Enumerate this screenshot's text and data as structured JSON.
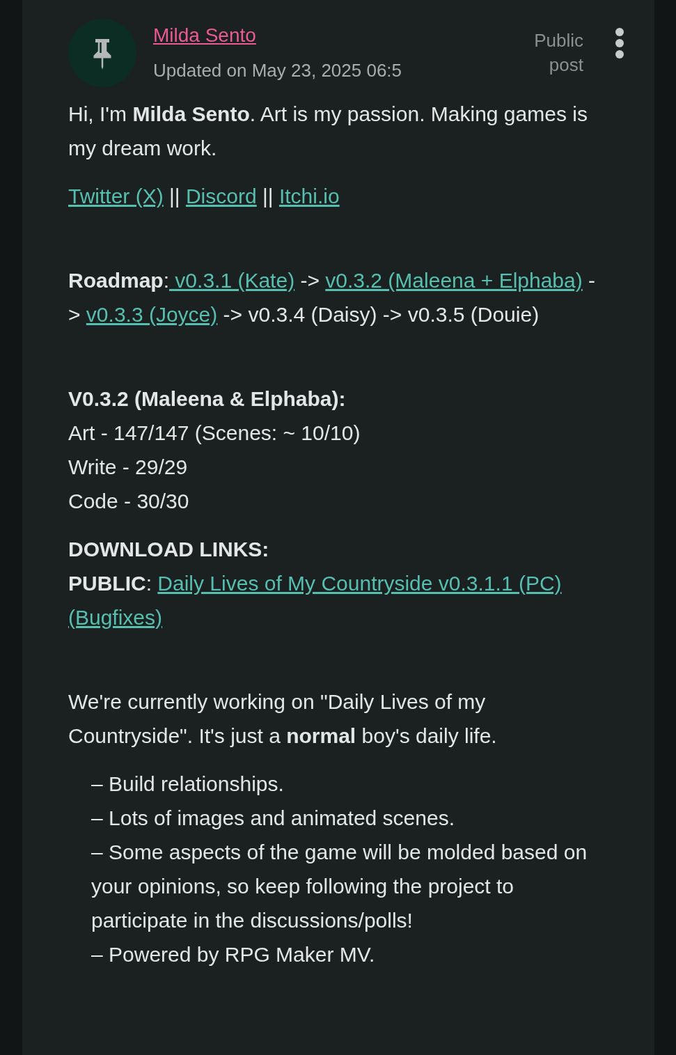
{
  "post": {
    "author": "Milda Sento",
    "updated": "Updated on May 23, 2025 06:5",
    "visibility": "Public post",
    "blocks": [
      {
        "kind": "paragraph",
        "lines": [
          [
            {
              "kind": "text",
              "text": "Hi, I'm **Milda Sento**. Art is my passion. Making games is my dream work."
            }
          ]
        ]
      },
      {
        "kind": "paragraph",
        "lines": [
          [
            {
              "kind": "link",
              "text": "Twitter (X)"
            },
            {
              "kind": "text",
              "text": " || "
            },
            {
              "kind": "link",
              "text": "Discord"
            },
            {
              "kind": "text",
              "text": " || "
            },
            {
              "kind": "link",
              "text": "Itchi.io"
            }
          ]
        ]
      },
      {
        "kind": "section",
        "lines": [
          [
            {
              "kind": "text",
              "text": "**Roadmap**:"
            },
            {
              "kind": "link",
              "text": " v0.3.1 (Kate)"
            },
            {
              "kind": "text",
              "text": " -> "
            },
            {
              "kind": "link",
              "text": "v0.3.2 (Maleena + Elphaba)"
            },
            {
              "kind": "text",
              "text": " -> "
            },
            {
              "kind": "link",
              "text": "v0.3.3 (Joyce)"
            },
            {
              "kind": "text",
              "text": " -> v0.3.4 (Daisy) -> v0.3.5 (Douie)"
            }
          ]
        ]
      },
      {
        "kind": "section",
        "lines": [
          [
            {
              "kind": "text",
              "text": "**V0.3.2 (Maleena & Elphaba):**"
            }
          ],
          [
            {
              "kind": "text",
              "text": "Art - 147/147 (Scenes: ~ 10/10)"
            }
          ],
          [
            {
              "kind": "text",
              "text": "Write -  29/29"
            }
          ],
          [
            {
              "kind": "text",
              "text": "Code - 30/30"
            }
          ]
        ]
      },
      {
        "kind": "paragraph",
        "lines": [
          [
            {
              "kind": "text",
              "text": "**DOWNLOAD LINKS:**"
            }
          ],
          [
            {
              "kind": "text",
              "text": "**PUBLIC**: "
            },
            {
              "kind": "link",
              "text": "Daily Lives of My Countryside v0.3.1.1 (PC)"
            }
          ],
          [
            {
              "kind": "link",
              "text": "(Bugfixes)"
            }
          ]
        ]
      },
      {
        "kind": "section",
        "lines": [
          [
            {
              "kind": "text",
              "text": "We're currently working on \"Daily Lives of my Countryside\". It's just a **normal** boy's daily life."
            }
          ]
        ]
      },
      {
        "kind": "list",
        "lines": [
          [
            {
              "kind": "text",
              "text": "– Build relationships."
            }
          ],
          [
            {
              "kind": "text",
              "text": "– Lots of images and animated scenes."
            }
          ],
          [
            {
              "kind": "text",
              "text": "– Some aspects of the game will be molded based on your opinions, so keep following the project to participate in the discussions/polls!"
            }
          ],
          [
            {
              "kind": "text",
              "text": "– Powered by RPG Maker MV."
            }
          ]
        ]
      }
    ]
  }
}
